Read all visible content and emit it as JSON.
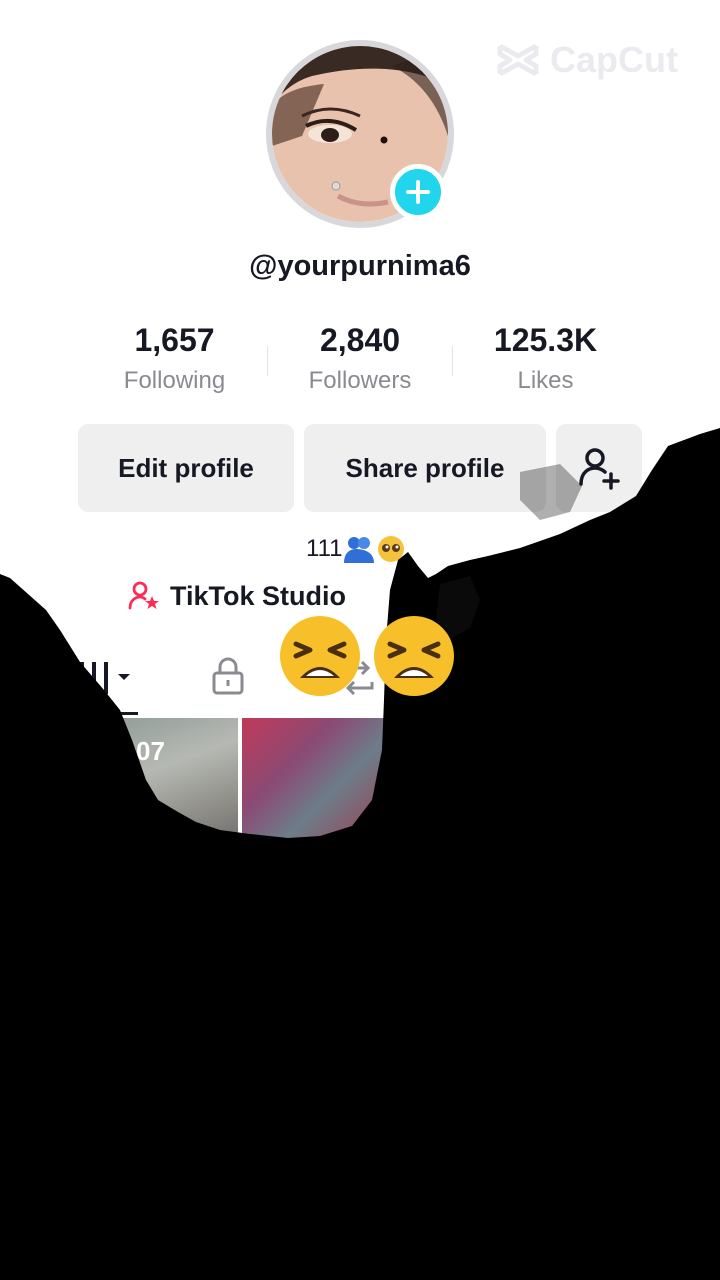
{
  "watermark": "CapCut",
  "profile": {
    "username": "@yourpurnima6"
  },
  "stats": [
    {
      "value": "1,657",
      "label": "Following"
    },
    {
      "value": "2,840",
      "label": "Followers"
    },
    {
      "value": "125.3K",
      "label": "Likes"
    }
  ],
  "buttons": {
    "edit_profile": "Edit profile",
    "share_profile": "Share profile"
  },
  "bio": {
    "text": "111"
  },
  "studio": {
    "label": "TikTok Studio"
  },
  "videos": [
    {
      "overlay_text": "07"
    }
  ],
  "colors": {
    "accent": "#20d5ec",
    "studio_icon": "#fe2c55",
    "button_bg": "#efeff0",
    "muted_text": "#8a8b91"
  },
  "icons": [
    "capcut-logo-icon",
    "plus-icon",
    "add-friend-icon",
    "studio-icon",
    "grid-icon",
    "lock-icon",
    "repost-icon"
  ]
}
